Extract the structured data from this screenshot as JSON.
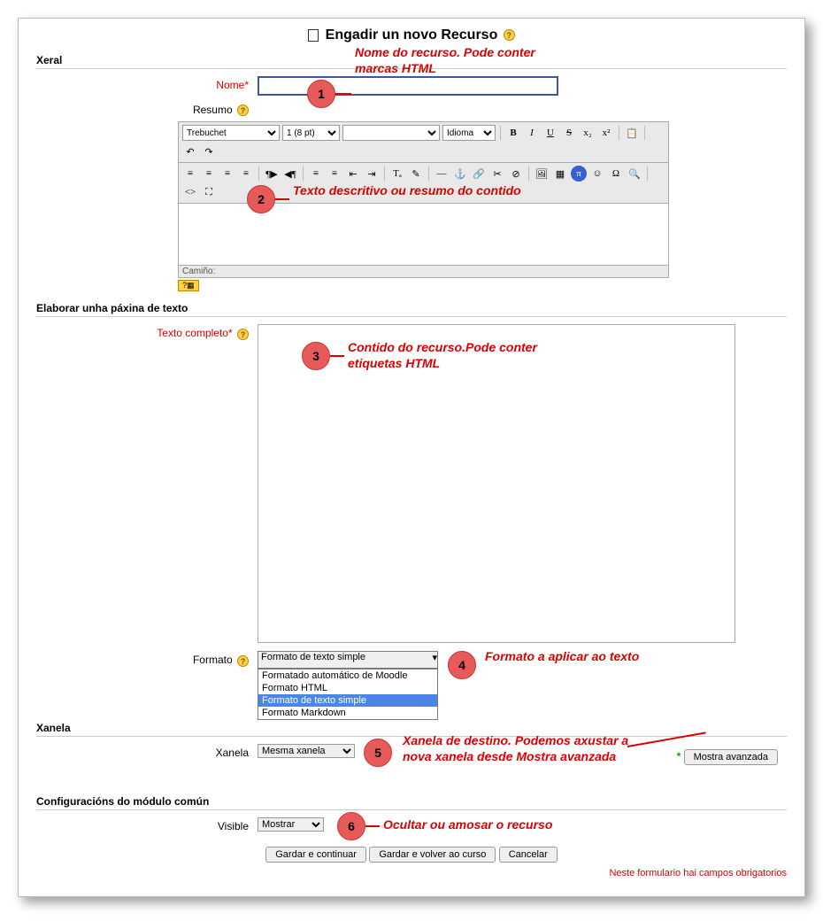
{
  "title": "Engadir un novo Recurso",
  "sections": {
    "xeral": {
      "header": "Xeral",
      "nome_label": "Nome*",
      "nome_value": "",
      "resumo_label": "Resumo",
      "editor": {
        "font_select": "Trebuchet",
        "size_select": "1 (8 pt)",
        "heading_select": "",
        "lang_select": "Idioma",
        "path_label": "Camiño:",
        "kb_label": "?▦"
      }
    },
    "elaborar": {
      "header": "Elaborar unha páxina de texto",
      "texto_label": "Texto completo*",
      "formato_label": "Formato",
      "formato_value": "Formato de texto simple",
      "formato_options": {
        "o1": "Formatado automático de Moodle",
        "o2": "Formato HTML",
        "o3": "Formato de texto simple",
        "o4": "Formato Markdown"
      }
    },
    "xanela": {
      "header": "Xanela",
      "xanela_label": "Xanela",
      "xanela_value": "Mesma xanela",
      "adv_button": "Mostra avanzada"
    },
    "common": {
      "header": "Configuracións do módulo común",
      "visible_label": "Visible",
      "visible_value": "Mostrar"
    }
  },
  "buttons": {
    "save_continue": "Gardar e continuar",
    "save_return": "Gardar e volver ao curso",
    "cancel": "Cancelar"
  },
  "footnote": "Neste formulario hai campos obrigatorios",
  "callouts": {
    "c1": {
      "num": "1",
      "text": "Nome do recurso. Pode conter marcas HTML"
    },
    "c2": {
      "num": "2",
      "text": "Texto descritivo ou resumo do contido"
    },
    "c3": {
      "num": "3",
      "text": "Contido do recurso.Pode conter etiquetas HTML"
    },
    "c4": {
      "num": "4",
      "text": "Formato a aplicar ao texto"
    },
    "c5": {
      "num": "5",
      "text": "Xanela de destino. Podemos axustar a nova xanela desde Mostra avanzada"
    },
    "c6": {
      "num": "6",
      "text": "Ocultar ou amosar o recurso"
    }
  },
  "icons": {
    "bold": "B",
    "italic": "I",
    "underline": "U",
    "strike": "S",
    "sub": "x₂",
    "sup": "x²",
    "copy": "📋",
    "undo": "↶",
    "redo": "↷",
    "al": "≡",
    "ac": "≡",
    "ar": "≡",
    "aj": "≡",
    "ltr": "¶▶",
    "rtl": "◀¶",
    "ol": "≡",
    "ul": "≡",
    "outd": "⇤",
    "ind": "⇥",
    "fg": "Tₐ",
    "bg": "✎",
    "hr": "—",
    "anchor": "⚓",
    "link": "🔗",
    "unlink": "✂",
    "nolink": "⊘",
    "img": "🖼",
    "table": "▦",
    "pi": "π",
    "smile": "☺",
    "char": "Ω",
    "find": "🔍",
    "code": "<>",
    "full": "⛶"
  }
}
